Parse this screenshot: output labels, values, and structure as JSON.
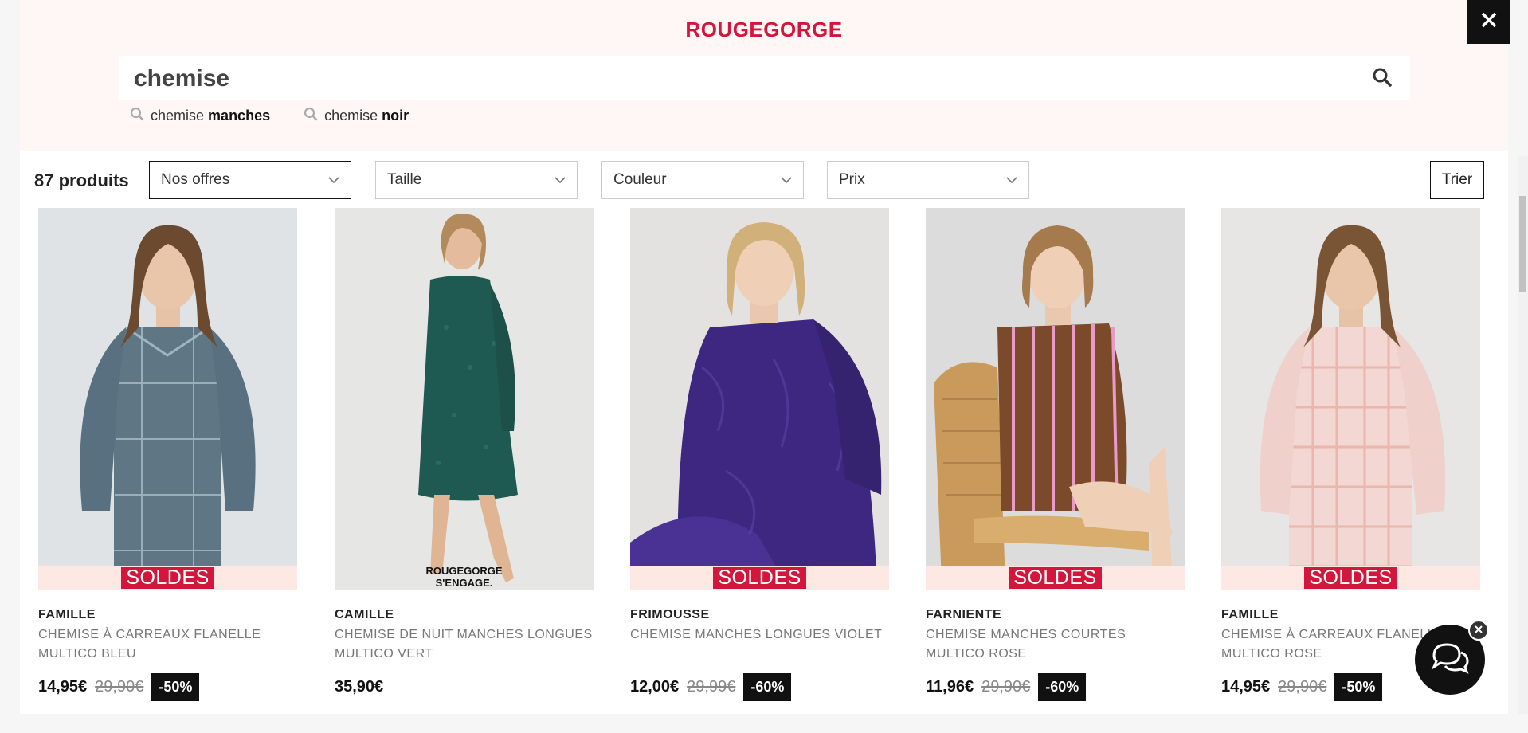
{
  "header": {
    "logo": "ROUGEGORGE"
  },
  "search": {
    "query": "chemise",
    "suggestions": [
      {
        "base": "chemise",
        "bold": "manches"
      },
      {
        "base": "chemise",
        "bold": "noir"
      }
    ]
  },
  "results": {
    "count": "87",
    "count_label": "produits",
    "filters": [
      "Nos offres",
      "Taille",
      "Couleur",
      "Prix"
    ],
    "sort_label": "Trier"
  },
  "sale_label": "SOLDES",
  "engage_label": [
    "ROUGEGORGE",
    "S'ENGAGE."
  ],
  "products": [
    {
      "brand": "FAMILLE",
      "name": "CHEMISE À CARREAUX FLANELLE MULTICO BLEU",
      "price": "14,95€",
      "old_price": "29,90€",
      "discount": "-50%"
    },
    {
      "brand": "CAMILLE",
      "name": "CHEMISE DE NUIT MANCHES LONGUES MULTICO VERT",
      "price": "35,90€",
      "old_price": "",
      "discount": ""
    },
    {
      "brand": "FRIMOUSSE",
      "name": "CHEMISE MANCHES LONGUES VIOLET",
      "price": "12,00€",
      "old_price": "29,99€",
      "discount": "-60%"
    },
    {
      "brand": "FARNIENTE",
      "name": "CHEMISE MANCHES COURTES MULTICO ROSE",
      "price": "11,96€",
      "old_price": "29,90€",
      "discount": "-60%"
    },
    {
      "brand": "FAMILLE",
      "name": "CHEMISE À CARREAUX FLANELLE MULTICO ROSE",
      "price": "14,95€",
      "old_price": "29,90€",
      "discount": "-50%"
    }
  ],
  "colors": {
    "brand_red": "#d3173c",
    "search_bg": "#fff7f5",
    "sale_band": "#fde8e4"
  },
  "icons": [
    "close-icon",
    "search-icon",
    "chevron-down-icon",
    "chat-icon"
  ]
}
